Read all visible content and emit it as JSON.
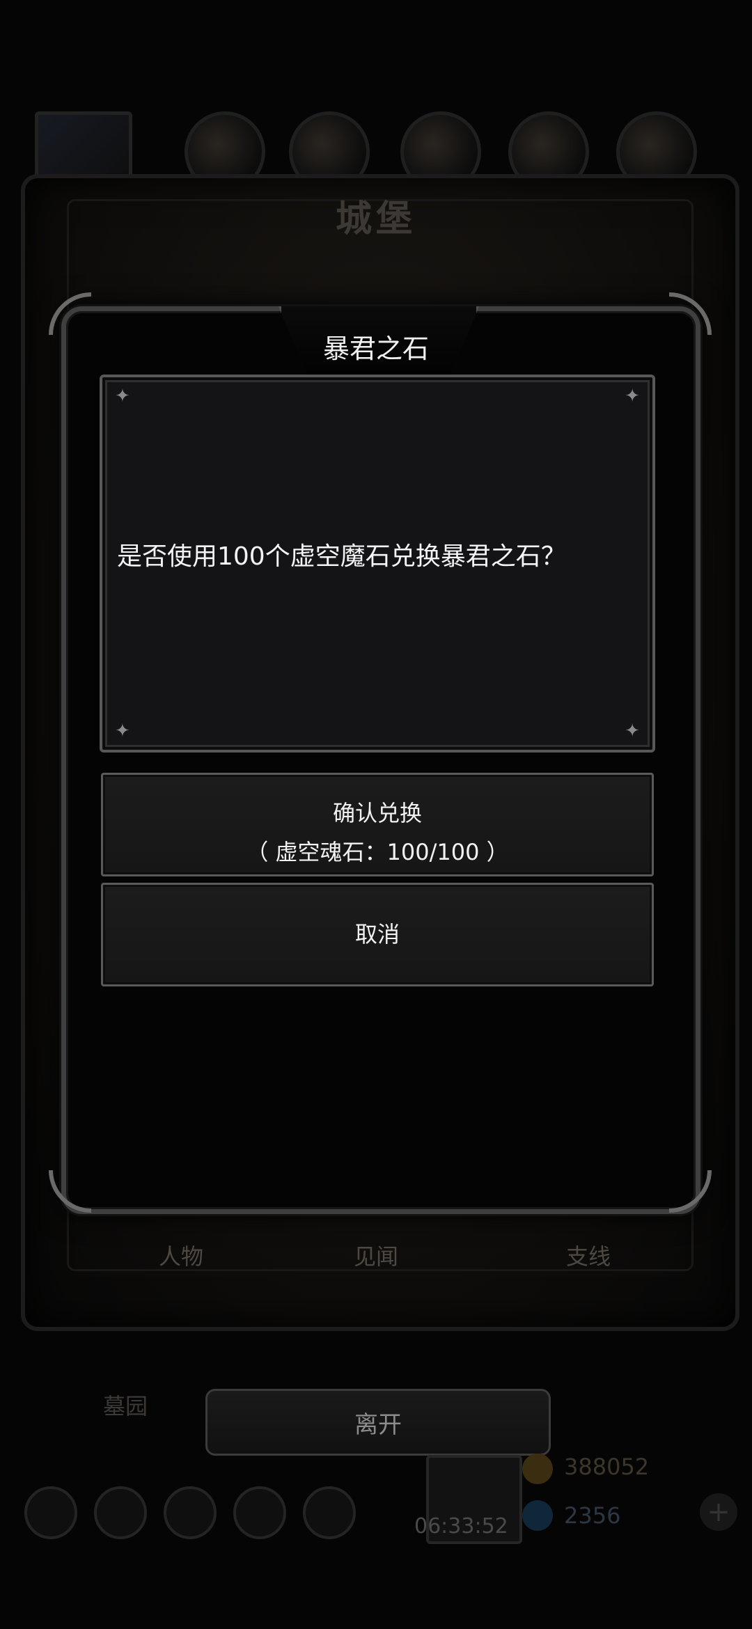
{
  "background": {
    "title": "城堡",
    "tabs": [
      "人物",
      "见闻",
      "支线"
    ],
    "gravestone_label": "墓园",
    "leave_label": "离开",
    "timer": "06:33:52",
    "gold": "388052",
    "gems": "2356",
    "plus_icon": "plus-icon"
  },
  "dialog": {
    "title": "暴君之石",
    "message": "是否使用100个虚空魔石兑换暴君之石？",
    "confirm": {
      "label": "确认兑换",
      "cost": "（ 虚空魂石：100/100 ）"
    },
    "cancel_label": "取消"
  },
  "colors": {
    "background": "#050505",
    "panel": "#141416",
    "border": "#5a5a5a",
    "text": "#f2f2f2"
  }
}
